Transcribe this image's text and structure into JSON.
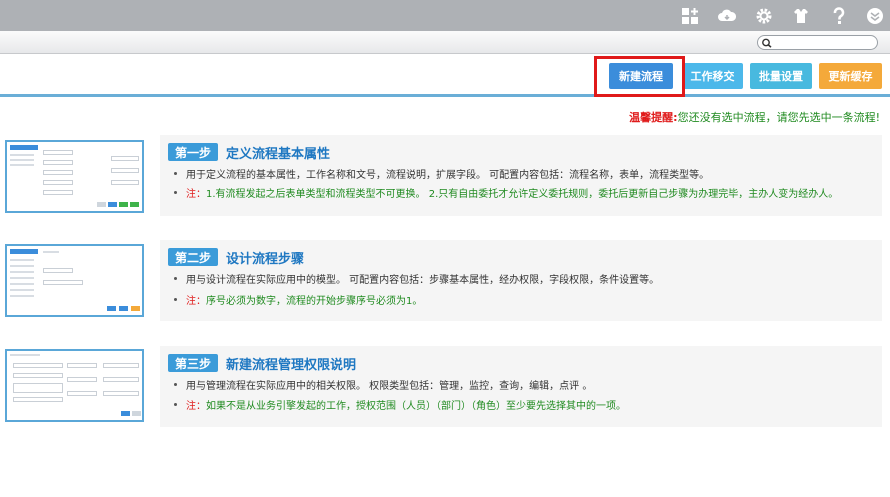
{
  "header": {
    "icons": [
      "grid-plus-icon",
      "cloud-icon",
      "gear-icon",
      "shirt-icon",
      "help-icon",
      "chevron-down-circle-icon"
    ]
  },
  "search": {
    "value": "",
    "placeholder": ""
  },
  "toolbar": {
    "new_flow": "新建流程",
    "move_work": "工作移交",
    "batch_settings": "批量设置",
    "update_cache": "更新缓存"
  },
  "warning": {
    "label": "温馨提醒:",
    "text": "您还没有选中流程，请您先选中一条流程!"
  },
  "steps": [
    {
      "badge": "第一步",
      "title": "定义流程基本属性",
      "desc": "用于定义流程的基本属性，工作名称和文号，流程说明，扩展字段。 可配置内容包括：流程名称，表单，流程类型等。",
      "note_label": "注：",
      "note_text": "1.有流程发起之后表单类型和流程类型不可更换。 2.只有自由委托才允许定义委托规则，委托后更新自己步骤为办理完毕，主办人变为经办人。"
    },
    {
      "badge": "第二步",
      "title": "设计流程步骤",
      "desc": "用与设计流程在实际应用中的模型。 可配置内容包括：步骤基本属性，经办权限，字段权限，条件设置等。",
      "note_label": "注：",
      "note_text": "序号必须为数字，流程的开始步骤序号必须为1。"
    },
    {
      "badge": "第三步",
      "title": "新建流程管理权限说明",
      "desc": "用与管理流程在实际应用中的相关权限。 权限类型包括：管理，监控，查询，编辑，点评 。",
      "note_label": "注：",
      "note_text": "如果不是从业务引擎发起的工作，授权范围（人员）（部门）（角色）至少要先选择其中的一项。"
    }
  ],
  "colors": {
    "topbar": "#aeb1b5",
    "accent": "#3b8ddb",
    "cache": "#f4a93a",
    "note_red": "#e01c1c",
    "note_green": "#1f8a1f"
  }
}
